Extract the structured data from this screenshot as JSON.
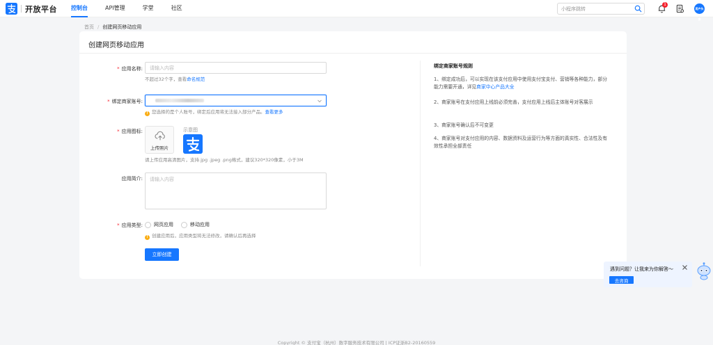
{
  "header": {
    "brand": "开放平台",
    "nav": [
      "控制台",
      "API管理",
      "学堂",
      "社区"
    ],
    "search_placeholder": "小程序跳转",
    "notification_count": "1",
    "avatar_text": "用户头像"
  },
  "breadcrumb": {
    "home": "首页",
    "separator": "/",
    "current": "创建网页移动应用"
  },
  "form": {
    "title": "创建网页移动应用",
    "name_label": "应用名称:",
    "name_placeholder": "请输入内容",
    "name_hint": "不超过32个字，查看",
    "name_hint_link": "命名规范",
    "merchant_label": "绑定商家账号:",
    "merchant_hint": "您选择的是个人账号，绑定后应用将无法接入部分产品。",
    "merchant_hint_link": "查看更多",
    "icon_label": "应用图标:",
    "upload_label": "上传照片",
    "sample_label": "示意图",
    "icon_hint": "请上传应用高清图片，支持.jpg .jpeg .png格式，建议320*320像素，小于3M",
    "intro_label": "应用简介:",
    "intro_placeholder": "请输入内容",
    "type_label": "应用类型:",
    "type_options": [
      "网页应用",
      "移动应用"
    ],
    "type_hint": "创建应用后，应用类型将无法修改，请确认后再选择",
    "submit_label": "立即创建"
  },
  "rules": {
    "title": "绑定商家账号规则",
    "r1_a": "1、绑定成功后，可以实现在该支付应用中使用支付宝支付、营销等各种能力，部分能力需要开通，详见",
    "r1_link": "商家中心产品大全",
    "r2": "2、商家账号在支付应用上线前必须完善，支付应用上线后主体账号对客展示",
    "r3": "3、商家账号确认后不可变更",
    "r4": "4、商家账号对支付应用的内容、数据资料及运营行为等方面的真实性、合法性及有效性承担全部责任"
  },
  "help": {
    "text": "遇到问题？让我来为你解答～",
    "button": "去咨询"
  },
  "footer": "Copyright © 支付宝（杭州）数字服务技术有限公司 | ICP证浙B2-20160559",
  "colors": {
    "accent": "#1677ff",
    "required": "#f5222d",
    "warning": "#faad14"
  },
  "icons": [
    "alipay-logo-icon",
    "search-icon",
    "bell-icon",
    "doc-icon",
    "chevron-down-icon",
    "upload-cloud-icon",
    "warning-icon",
    "close-icon",
    "robot-icon"
  ]
}
